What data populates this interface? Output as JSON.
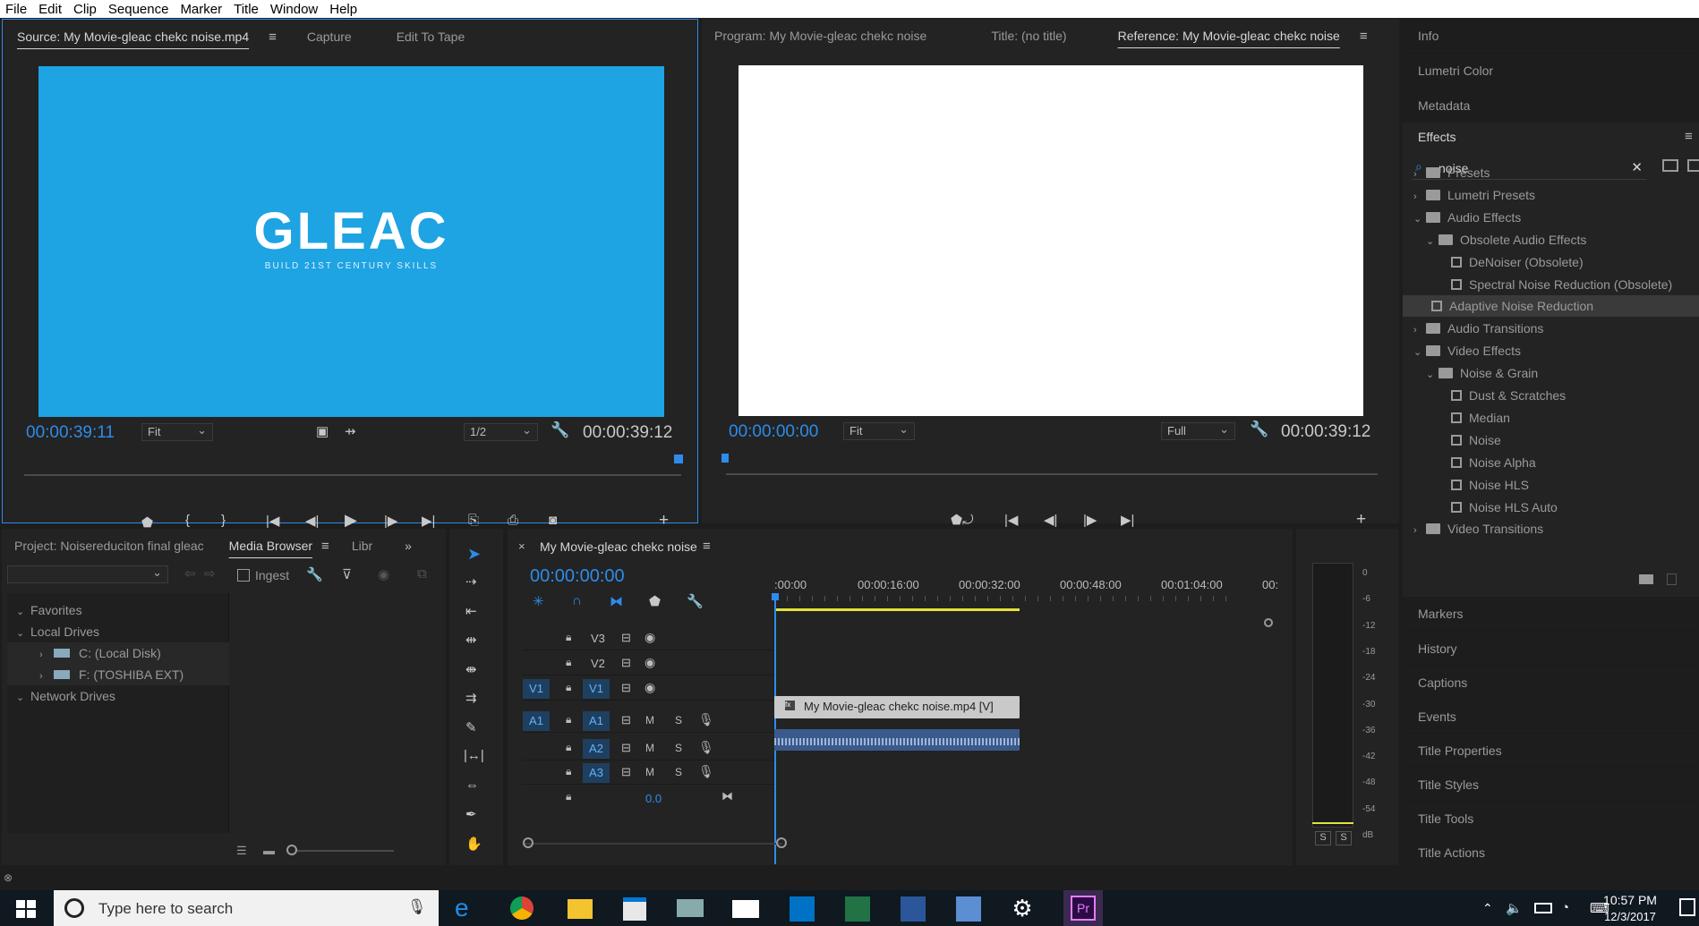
{
  "menu": [
    "File",
    "Edit",
    "Clip",
    "Sequence",
    "Marker",
    "Title",
    "Window",
    "Help"
  ],
  "source": {
    "tabs": [
      "Source: My Movie-gleac chekc noise.mp4",
      "Capture",
      "Edit To Tape"
    ],
    "logo": "GLEAC",
    "tagline": "BUILD 21ST CENTURY SKILLS",
    "timecode": "00:00:39:11",
    "fit": "Fit",
    "res": "1/2",
    "duration": "00:00:39:12",
    "bg_color": "#1ea3e3"
  },
  "program": {
    "tabs": [
      "Program: My Movie-gleac chekc noise",
      "Title: (no title)",
      "Reference: My Movie-gleac chekc noise"
    ],
    "timecode": "00:00:00:00",
    "fit": "Fit",
    "res": "Full",
    "duration": "00:00:39:12"
  },
  "right_panels_top": [
    "Info",
    "Lumetri Color",
    "Metadata"
  ],
  "effects": {
    "title": "Effects",
    "search": "noise",
    "tree": [
      {
        "label": "Presets",
        "level": 0,
        "kind": "folder"
      },
      {
        "label": "Lumetri Presets",
        "level": 0,
        "kind": "folder"
      },
      {
        "label": "Audio Effects",
        "level": 0,
        "kind": "folder",
        "open": true
      },
      {
        "label": "Obsolete Audio Effects",
        "level": 1,
        "kind": "folder",
        "open": true
      },
      {
        "label": "DeNoiser (Obsolete)",
        "level": 2,
        "kind": "fx"
      },
      {
        "label": "Spectral Noise Reduction (Obsolete)",
        "level": 2,
        "kind": "fx"
      },
      {
        "label": "Adaptive Noise Reduction",
        "level": 1,
        "kind": "fx",
        "selected": true
      },
      {
        "label": "Audio Transitions",
        "level": 0,
        "kind": "folder"
      },
      {
        "label": "Video Effects",
        "level": 0,
        "kind": "folder",
        "open": true
      },
      {
        "label": "Noise & Grain",
        "level": 1,
        "kind": "folder",
        "open": true
      },
      {
        "label": "Dust & Scratches",
        "level": 2,
        "kind": "fx"
      },
      {
        "label": "Median",
        "level": 2,
        "kind": "fx"
      },
      {
        "label": "Noise",
        "level": 2,
        "kind": "fx"
      },
      {
        "label": "Noise Alpha",
        "level": 2,
        "kind": "fx"
      },
      {
        "label": "Noise HLS",
        "level": 2,
        "kind": "fx"
      },
      {
        "label": "Noise HLS Auto",
        "level": 2,
        "kind": "fx"
      },
      {
        "label": "Video Transitions",
        "level": 0,
        "kind": "folder"
      }
    ]
  },
  "right_panels_bottom": [
    "Markers",
    "History",
    "Captions",
    "Events",
    "Title Properties",
    "Title Styles",
    "Title Tools",
    "Title Actions"
  ],
  "project": {
    "tabs": [
      "Project: Noisereduciton final gleac",
      "Media Browser",
      "Libr"
    ],
    "ingest": "Ingest",
    "tree": [
      {
        "label": "Favorites",
        "level": 0
      },
      {
        "label": "Local Drives",
        "level": 0
      },
      {
        "label": "C: (Local Disk)",
        "level": 1
      },
      {
        "label": "F: (TOSHIBA EXT)",
        "level": 1
      },
      {
        "label": "Network Drives",
        "level": 0
      }
    ]
  },
  "timeline": {
    "title": "My Movie-gleac chekc noise",
    "timecode": "00:00:00:00",
    "ruler": [
      ":00:00",
      "00:00:16:00",
      "00:00:32:00",
      "00:00:48:00",
      "00:01:04:00",
      "00:"
    ],
    "video_tracks": [
      "V3",
      "V2",
      "V1"
    ],
    "audio_tracks": [
      "A1",
      "A2",
      "A3"
    ],
    "src_v": "V1",
    "src_a": "A1",
    "clip_label": "My Movie-gleac chekc noise.mp4 [V]",
    "master_value": "0.0",
    "m": "M",
    "s": "S"
  },
  "meter": {
    "labels": [
      "0",
      "-6",
      "-12",
      "-18",
      "-24",
      "-30",
      "-36",
      "-42",
      "-48",
      "-54",
      "dB"
    ],
    "solo": [
      "S",
      "S"
    ]
  },
  "taskbar": {
    "search": "Type here to search",
    "time": "10:57 PM",
    "date": "12/3/2017"
  }
}
